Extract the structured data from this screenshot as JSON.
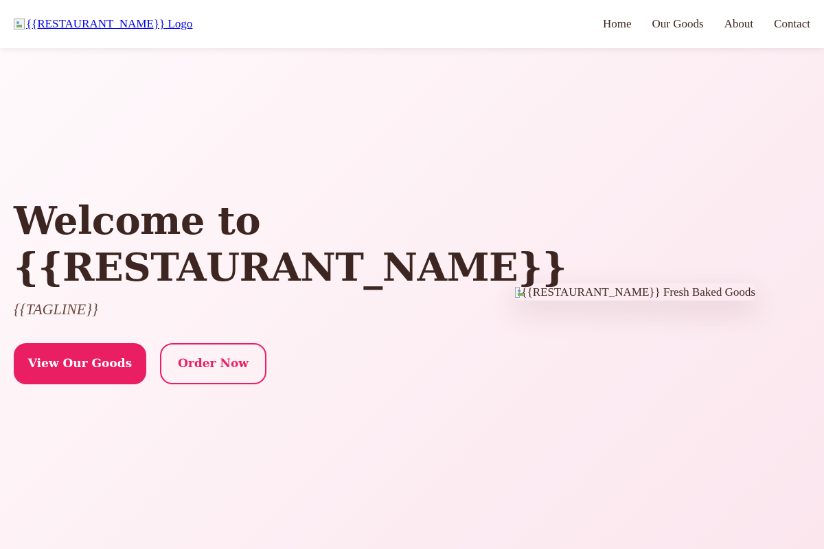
{
  "header": {
    "logo_alt": "{{RESTAURANT_NAME}} Logo",
    "nav": [
      {
        "label": "Home"
      },
      {
        "label": "Our Goods"
      },
      {
        "label": "About"
      },
      {
        "label": "Contact"
      }
    ]
  },
  "hero": {
    "title_line1": "Welcome to",
    "title_line2": "{{RESTAURANT_NAME}}",
    "tagline": "{{TAGLINE}}",
    "primary_button": "View Our Goods",
    "secondary_button": "Order Now",
    "image_alt": "{{RESTAURANT_NAME}} Fresh Baked Goods"
  },
  "colors": {
    "accent": "#e91e63",
    "text_dark": "#3d2621",
    "link": "#0000ee"
  }
}
